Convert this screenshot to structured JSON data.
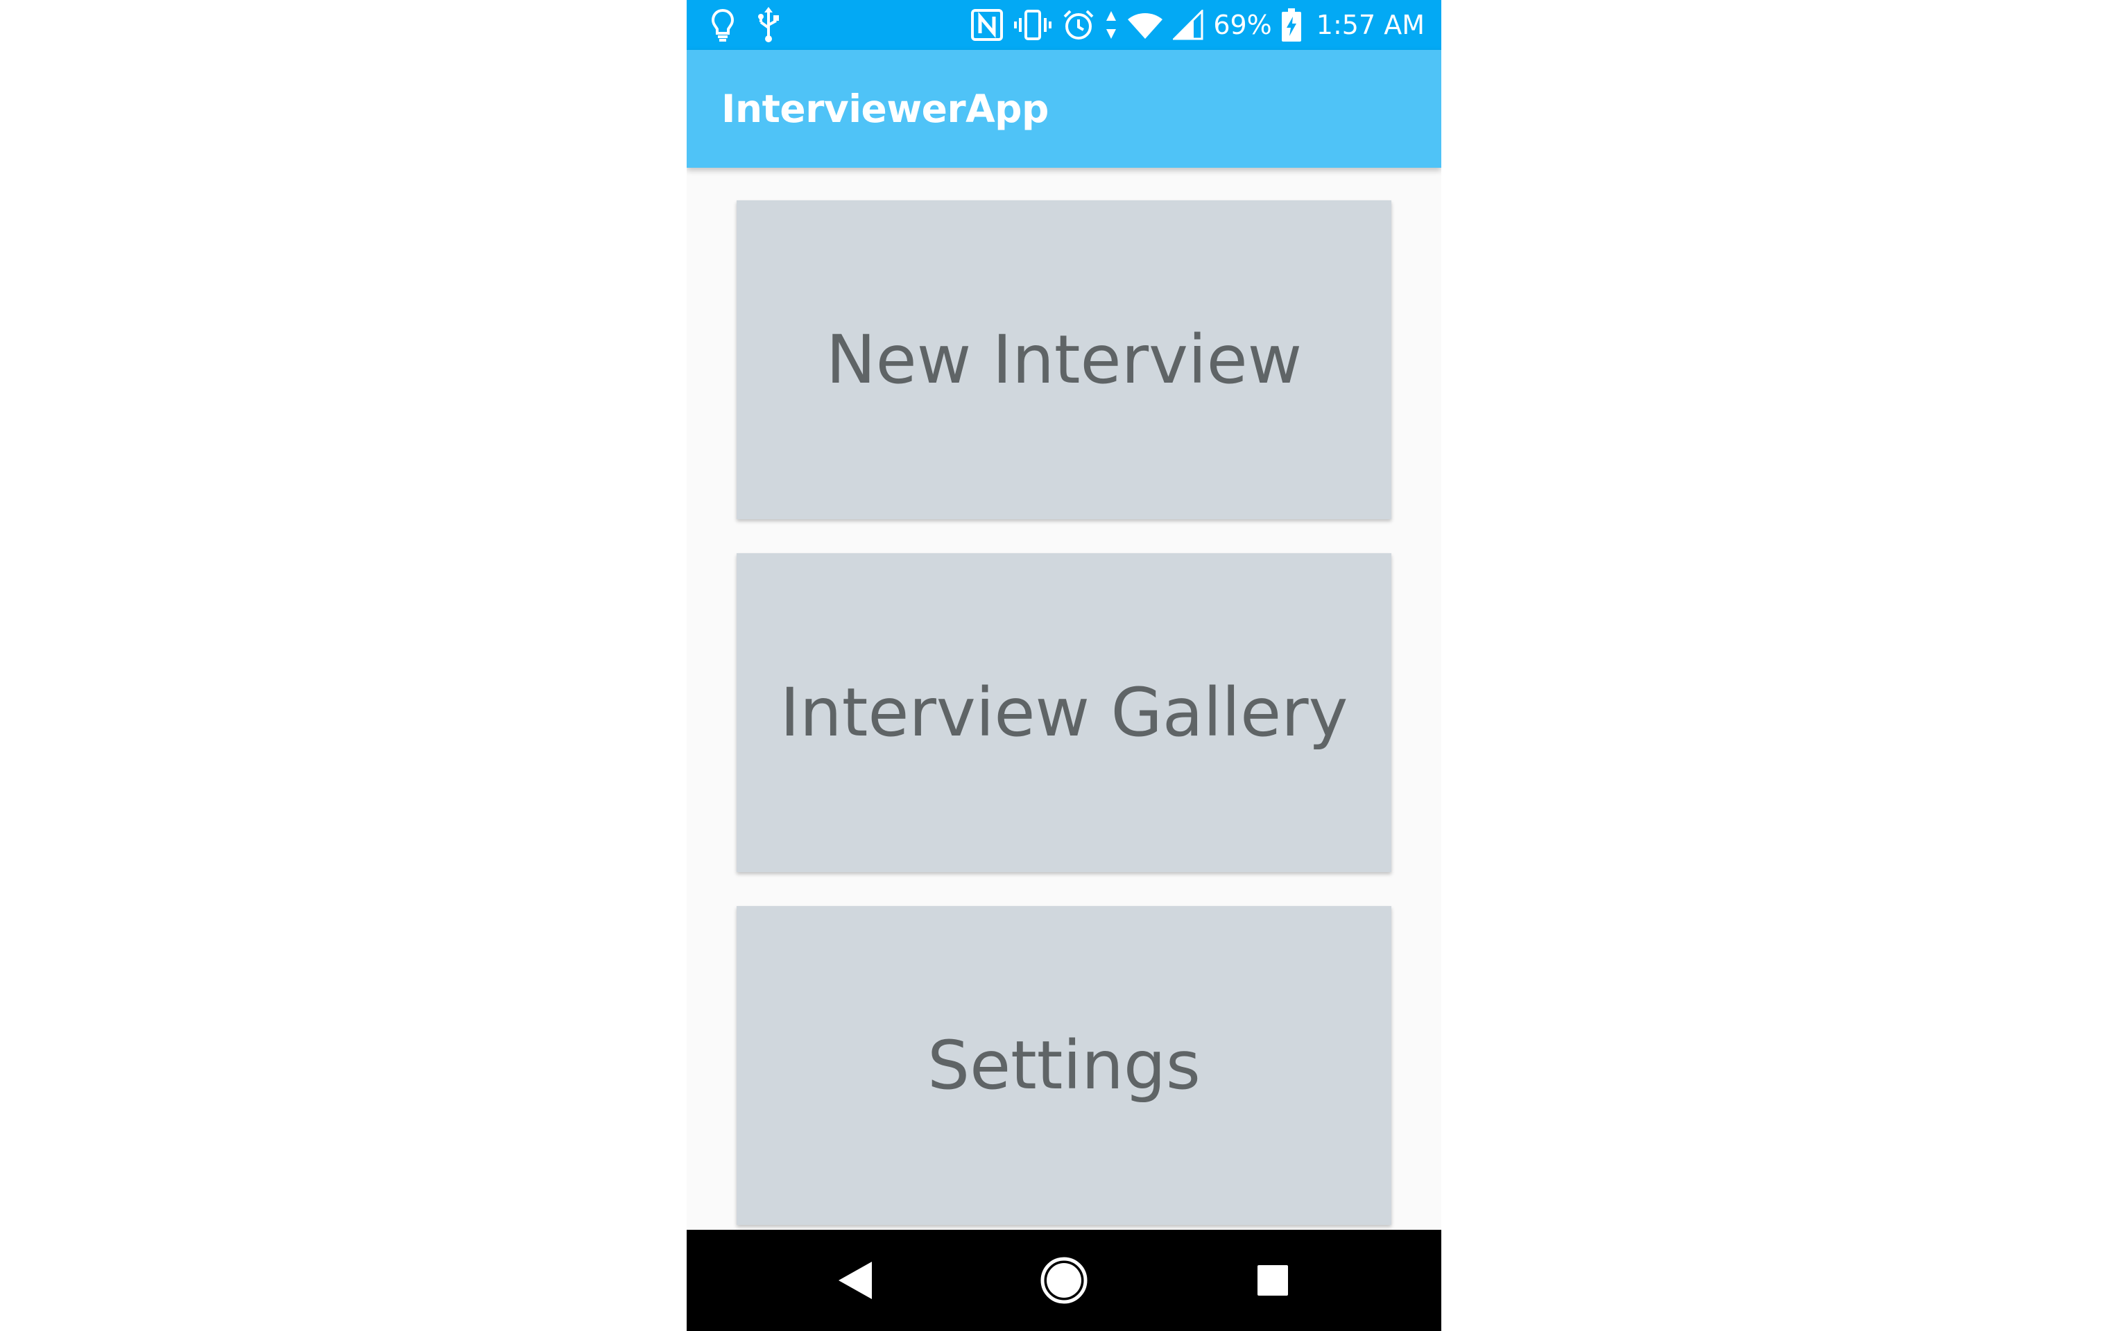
{
  "status_bar": {
    "left_icons": [
      "lightbulb-icon",
      "usb-icon"
    ],
    "right_icons": [
      "nfc-icon",
      "vibrate-icon",
      "alarm-icon",
      "data-arrows-icon",
      "wifi-icon",
      "cell-signal-icon"
    ],
    "battery_percent": "69%",
    "battery_icon": "battery-charging-icon",
    "time": "1:57 AM",
    "background_color": "#03a9f4"
  },
  "app_bar": {
    "title": "InterviewerApp",
    "background_color": "#4fc3f7"
  },
  "menu": {
    "buttons": [
      {
        "label": "New Interview"
      },
      {
        "label": "Interview Gallery"
      },
      {
        "label": "Settings"
      }
    ],
    "button_color": "#d0d7dd",
    "text_color": "#5f6466"
  },
  "nav_bar": {
    "icons": [
      "back-icon",
      "home-icon",
      "recents-icon"
    ],
    "background_color": "#000000"
  }
}
